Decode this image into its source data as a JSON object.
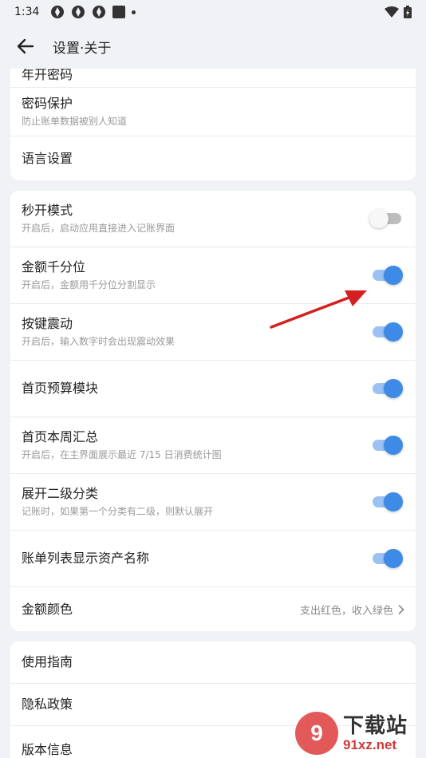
{
  "status_bar": {
    "time": "1:34"
  },
  "header": {
    "title": "设置·关于"
  },
  "card1": {
    "cut_item": "年开密码",
    "items": [
      {
        "title": "密码保护",
        "subtitle": "防止账单数据被别人知道"
      },
      {
        "title": "语言设置"
      }
    ]
  },
  "card2": {
    "items": [
      {
        "title": "秒开模式",
        "subtitle": "开启后，启动应用直接进入记账界面",
        "toggle": false
      },
      {
        "title": "金额千分位",
        "subtitle": "开启后，金额用千分位分割显示",
        "toggle": true
      },
      {
        "title": "按键震动",
        "subtitle": "开启后，输入数字时会出现震动效果",
        "toggle": true
      },
      {
        "title": "首页预算模块",
        "toggle": true
      },
      {
        "title": "首页本周汇总",
        "subtitle": "开启后，在主界面展示最近 7/15 日消费统计图",
        "toggle": true
      },
      {
        "title": "展开二级分类",
        "subtitle": "记账时，如果第一个分类有二级，则默认展开",
        "toggle": true
      },
      {
        "title": "账单列表显示资产名称",
        "toggle": true
      },
      {
        "title": "金额颜色",
        "value": "支出红色，收入绿色"
      }
    ]
  },
  "card3": {
    "items": [
      {
        "title": "使用指南"
      },
      {
        "title": "隐私政策"
      },
      {
        "title": "版本信息"
      }
    ]
  },
  "watermark": {
    "logo": "9",
    "title": "下载站",
    "domain": "91xz.net"
  },
  "colors": {
    "accent": "#3d8be6",
    "accent_track": "#9cc2f5",
    "annotation_arrow": "#d42020"
  }
}
